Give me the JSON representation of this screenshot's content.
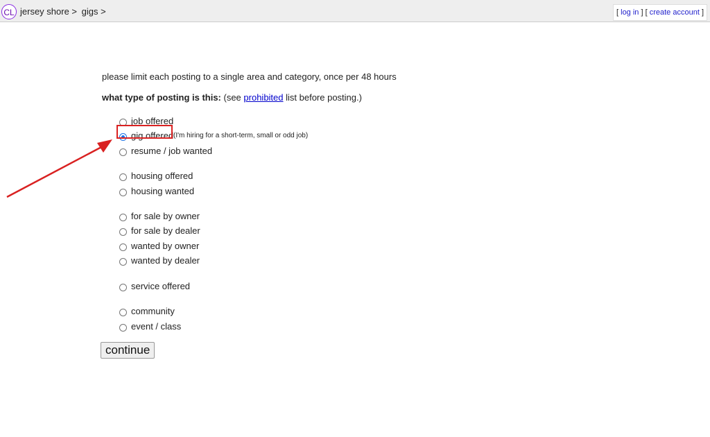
{
  "header": {
    "logo": "CL",
    "breadcrumb": [
      "jersey shore >",
      "gigs >"
    ],
    "login_label": "log in",
    "create_account_label": "create account",
    "bracket_open": "[",
    "bracket_mid": "] [",
    "bracket_close": "]"
  },
  "main": {
    "limit_note": "please limit each posting to a single area and category, once per 48 hours",
    "question_bold": "what type of posting is this:",
    "question_pre_link": " (see ",
    "prohibited_link": "prohibited",
    "question_post_link": " list before posting.)",
    "options": [
      {
        "label": "job offered",
        "checked": false
      },
      {
        "label": "gig offered",
        "checked": true,
        "hint": "(I'm hiring for a short-term, small or odd job)"
      },
      {
        "label": "resume / job wanted",
        "checked": false
      },
      {
        "label": "housing offered",
        "checked": false
      },
      {
        "label": "housing wanted",
        "checked": false
      },
      {
        "label": "for sale by owner",
        "checked": false
      },
      {
        "label": "for sale by dealer",
        "checked": false
      },
      {
        "label": "wanted by owner",
        "checked": false
      },
      {
        "label": "wanted by dealer",
        "checked": false
      },
      {
        "label": "service offered",
        "checked": false
      },
      {
        "label": "community",
        "checked": false
      },
      {
        "label": "event / class",
        "checked": false
      }
    ],
    "continue_label": "continue"
  },
  "annotation": {
    "color": "#d92121"
  }
}
